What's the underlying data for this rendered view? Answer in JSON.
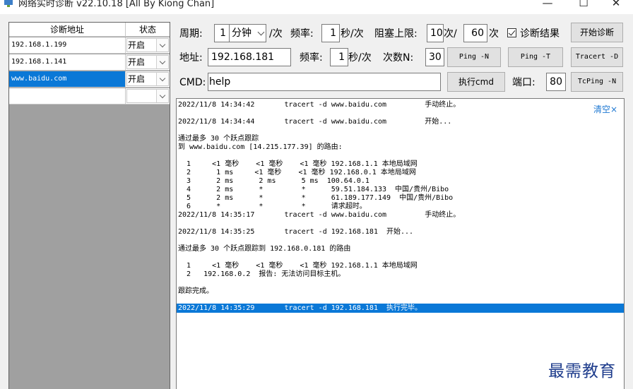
{
  "window": {
    "title": "网络实时诊断 v22.10.18 [All By Kiong Chan]",
    "minimize": "—",
    "maximize": "☐",
    "close": "✕"
  },
  "table": {
    "col_address": "诊断地址",
    "col_status": "状态",
    "rows": [
      {
        "address": "192.168.1.199",
        "status": "开启"
      },
      {
        "address": "192.168.1.141",
        "status": "开启"
      },
      {
        "address": "www.baidu.com",
        "status": "开启"
      },
      {
        "address": "",
        "status": ""
      }
    ],
    "selected_index": 2
  },
  "controls": {
    "period_label": "周期:",
    "period_value": "1",
    "period_unit": "分钟",
    "per_time": "/次",
    "freq_label": "频率:",
    "freq_value": "1",
    "freq_unit": "秒/次",
    "block_label": "阻塞上限:",
    "block_value1": "10",
    "block_unit1": "次/",
    "block_value2": "60",
    "block_unit2": "次",
    "diag_result_label": "诊断结果",
    "diag_result_checked": true,
    "start_button": "开始诊断",
    "addr_label": "地址:",
    "addr_value": "192.168.181",
    "freq2_label": "频率:",
    "freq2_value": "1",
    "freq2_unit": "秒/次",
    "count_label": "次数N:",
    "count_value": "30",
    "ping_n_button": "Ping -N",
    "ping_t_button": "Ping -T",
    "tracert_button": "Tracert -D",
    "cmd_label": "CMD:",
    "cmd_value": "help",
    "exec_button": "执行cmd",
    "port_label": "端口:",
    "port_value": "80",
    "tcping_button": "TcPing -N"
  },
  "log": {
    "clear_label": "清空×",
    "lines": [
      "2022/11/8 14:34:42       tracert -d www.baidu.com         手动终止。",
      "",
      "2022/11/8 14:34:44       tracert -d www.baidu.com         开始...",
      "",
      "通过最多 30 个跃点跟踪",
      "到 www.baidu.com [14.215.177.39] 的路由:",
      "",
      "  1     <1 毫秒    <1 毫秒    <1 毫秒 192.168.1.1 本地局域网",
      "  2      1 ms     <1 毫秒    <1 毫秒 192.168.0.1 本地局域网",
      "  3      2 ms      2 ms      5 ms  100.64.0.1",
      "  4      2 ms      *         *      59.51.184.133  中国/贵州/Bibo",
      "  5      2 ms      *         *      61.189.177.149  中国/贵州/Bibo",
      "  6      *         *         *      请求超时。",
      "2022/11/8 14:35:17       tracert -d www.baidu.com         手动终止。",
      "",
      "2022/11/8 14:35:25       tracert -d 192.168.181  开始...",
      "",
      "通过最多 30 个跃点跟踪到 192.168.0.181 的路由",
      "",
      "  1     <1 毫秒    <1 毫秒    <1 毫秒 192.168.1.1 本地局域网",
      "  2   192.168.0.2  报告: 无法访问目标主机。",
      "",
      "跟踪完成。",
      "",
      "2022/11/8 14:35:29       tracert -d 192.168.181  执行完毕。"
    ],
    "highlighted_line": 24
  },
  "watermark": "最需教育",
  "colors": {
    "selection": "#0a78d7",
    "link": "#1e78d2",
    "watermark": "#1e3c8c"
  }
}
